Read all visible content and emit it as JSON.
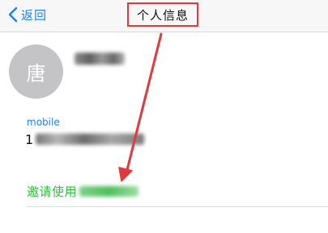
{
  "nav": {
    "back_label": "返回",
    "title": "个人信息"
  },
  "profile": {
    "avatar_char": "唐"
  },
  "mobile": {
    "label": "mobile",
    "value_prefix": "1"
  },
  "invite": {
    "label": "邀请使用"
  },
  "colors": {
    "accent_blue": "#1a82f7",
    "invite_green": "#2bbf3b",
    "annotation_red": "#e0393e",
    "avatar_gray": "#c4c4c6"
  },
  "icons": {
    "back": "chevron-left-icon"
  }
}
